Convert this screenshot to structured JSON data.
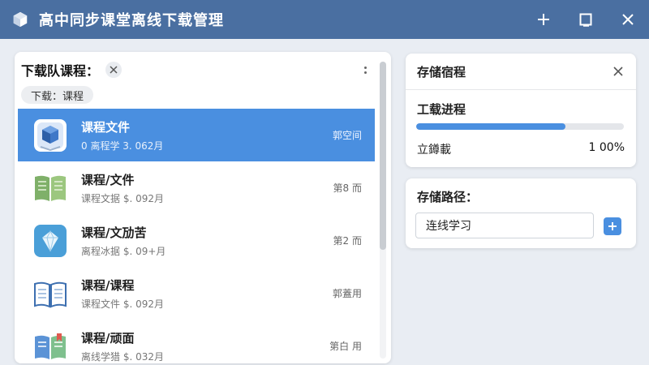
{
  "window": {
    "title": "高中同步课堂离线下载管理",
    "icons": {
      "app": "cube-icon",
      "add": "plus-icon",
      "maximize": "maximize-icon",
      "close": "close-icon"
    }
  },
  "queue": {
    "title": "下载队课程：",
    "filter_chip": "下载：课程",
    "items": [
      {
        "name": "课程文件",
        "sub": "0 离程学 3. 062月",
        "stat": "郭空间",
        "icon": "cube-book-icon",
        "selected": true
      },
      {
        "name": "课程/文件",
        "sub": "课程文据 $. 092月",
        "stat": "第8 而",
        "icon": "green-book-icon",
        "selected": false
      },
      {
        "name": "课程/文劢苦",
        "sub": "离程冰据 $. 09+月",
        "stat": "第2 而",
        "icon": "diamond-icon",
        "selected": false
      },
      {
        "name": "课程/课程",
        "sub": "课程文件 $. 092月",
        "stat": "郭蓋用",
        "icon": "open-book-icon",
        "selected": false
      },
      {
        "name": "课程/顽面",
        "sub": "离线学猎 $. 032月",
        "stat": "第白 用",
        "icon": "bookmark-book-icon",
        "selected": false
      }
    ]
  },
  "storage": {
    "title": "存储宿程",
    "progress_label": "工载进程",
    "progress": 0.72,
    "status_label": "立鐏載",
    "status_value": "1 00%"
  },
  "path": {
    "title": "存储路径：",
    "input_value": "连线学习"
  },
  "colors": {
    "titlebar": "#4a6fa1",
    "accent": "#4a8fe0",
    "background": "#e9edf3"
  }
}
